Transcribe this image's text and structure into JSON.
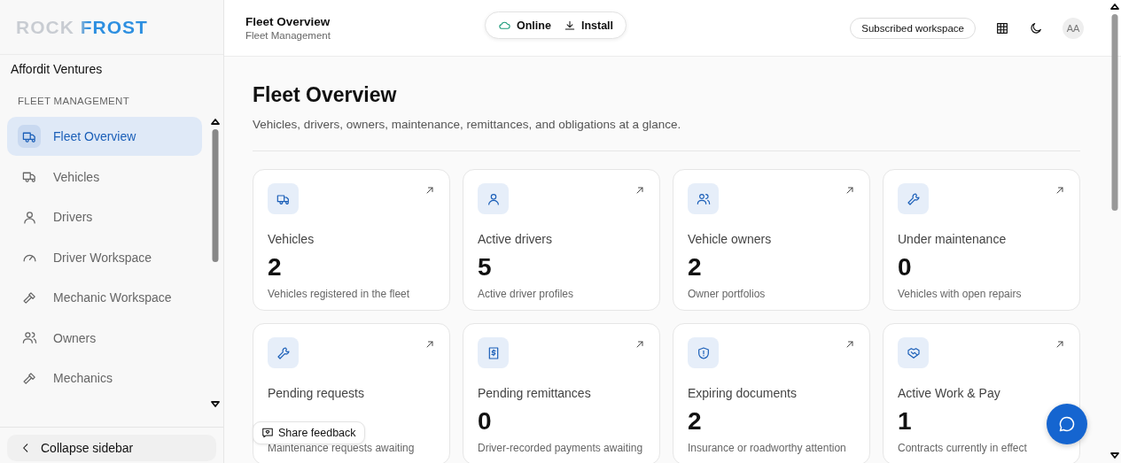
{
  "logo": {
    "text": "ROCK FROST"
  },
  "sidebar": {
    "workspace": "Affordit Ventures",
    "section": "FLEET MANAGEMENT",
    "items": [
      {
        "label": "Fleet Overview",
        "selected": true
      },
      {
        "label": "Vehicles",
        "selected": false
      },
      {
        "label": "Drivers",
        "selected": false
      },
      {
        "label": "Driver Workspace",
        "selected": false
      },
      {
        "label": "Mechanic Workspace",
        "selected": false
      },
      {
        "label": "Owners",
        "selected": false
      },
      {
        "label": "Mechanics",
        "selected": false
      }
    ],
    "collapse": "Collapse sidebar"
  },
  "header": {
    "title": "Fleet Overview",
    "subtitle": "Fleet Management",
    "status": "Online",
    "install": "Install",
    "workspace": "Subscribed workspace",
    "avatar": "AA"
  },
  "page": {
    "title": "Fleet Overview",
    "description": "Vehicles, drivers, owners, maintenance, remittances, and obligations at a glance."
  },
  "cards": [
    {
      "label": "Vehicles",
      "value": "2",
      "caption": "Vehicles registered in the fleet"
    },
    {
      "label": "Active drivers",
      "value": "5",
      "caption": "Active driver profiles"
    },
    {
      "label": "Vehicle owners",
      "value": "2",
      "caption": "Owner portfolios"
    },
    {
      "label": "Under maintenance",
      "value": "0",
      "caption": "Vehicles with open repairs"
    },
    {
      "label": "Pending requests",
      "caption": "Maintenance requests awaiting"
    },
    {
      "label": "Pending remittances",
      "value": "0",
      "caption": "Driver-recorded payments awaiting"
    },
    {
      "label": "Expiring documents",
      "value": "2",
      "caption": "Insurance or roadworthy attention"
    },
    {
      "label": "Active Work & Pay",
      "value": "1",
      "caption": "Contracts currently in effect"
    }
  ],
  "feedback": "Share feedback"
}
